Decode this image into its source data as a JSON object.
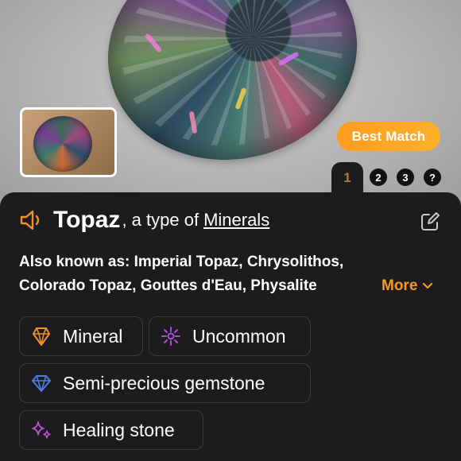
{
  "badge": {
    "best_match": "Best Match"
  },
  "pages": {
    "current": "1",
    "others": [
      "2",
      "3",
      "?"
    ]
  },
  "header": {
    "name": "Topaz",
    "type_prefix": ", a type of",
    "category": "Minerals"
  },
  "aka": {
    "label": "Also known as:",
    "line1": "Imperial Topaz, Chrysolithos,",
    "line2": "Colorado Topaz, Gouttes d'Eau, Physalite",
    "more": "More"
  },
  "tags": [
    {
      "label": "Mineral",
      "icon": "mineral-crystal-icon",
      "color": "#f0902c"
    },
    {
      "label": "Uncommon",
      "icon": "rarity-sparkle-icon",
      "color": "#b14ad8"
    },
    {
      "label": "Semi-precious gemstone",
      "icon": "diamond-icon",
      "color": "#4f7be0"
    },
    {
      "label": "Healing stone",
      "icon": "sparkles-icon",
      "color": "#c24fd6"
    }
  ],
  "colors": {
    "accent": "#f59a23",
    "background": "#1c1c1e",
    "chip_border": "#3a3a3c"
  }
}
